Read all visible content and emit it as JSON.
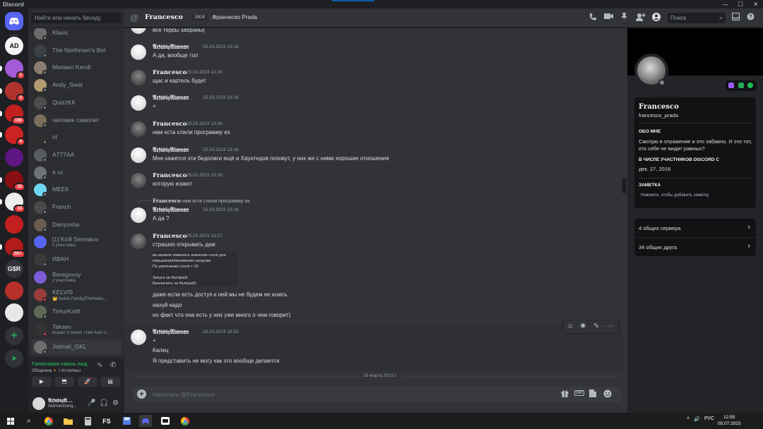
{
  "titlebar": {
    "app": "Discord",
    "min": "—",
    "max": "☐",
    "close": "✕"
  },
  "rail": {
    "servers": [
      {
        "label": "AD",
        "color": "#f2f3f5",
        "textcolor": "#111214",
        "badge": ""
      },
      {
        "label": "",
        "color": "#a35bd6",
        "textcolor": "#fff",
        "badge": "3"
      },
      {
        "label": "",
        "color": "#b0342e",
        "textcolor": "#fff",
        "badge": "3"
      },
      {
        "label": "",
        "color": "#c21f1f",
        "textcolor": "#fff",
        "badge": "150"
      },
      {
        "label": "",
        "color": "#cc2222",
        "textcolor": "#fff",
        "badge": "4"
      },
      {
        "label": "",
        "color": "#5e1780",
        "textcolor": "#fff",
        "badge": ""
      },
      {
        "label": "",
        "color": "#8a0f12",
        "textcolor": "#fff",
        "badge": "10"
      },
      {
        "label": "",
        "color": "#ededed",
        "textcolor": "#111",
        "badge": "10"
      },
      {
        "label": "",
        "color": "#c21f1f",
        "textcolor": "#fff",
        "badge": ""
      },
      {
        "label": "",
        "color": "#b31b1b",
        "textcolor": "#fff",
        "badge": "1K+"
      },
      {
        "label": "G$R",
        "color": "#313338",
        "textcolor": "#f2f3f5",
        "badge": ""
      },
      {
        "label": "",
        "color": "#b8302a",
        "textcolor": "#fff",
        "badge": ""
      },
      {
        "label": "",
        "color": "#e8e8e8",
        "textcolor": "#111",
        "badge": ""
      }
    ],
    "add": "+",
    "explore": "➤"
  },
  "sidebar": {
    "search_placeholder": "Найти или начать беседу",
    "dms": [
      {
        "name": "Klaus.",
        "sub": "",
        "avatar": "#6b6b6b",
        "status": "#80848e"
      },
      {
        "name": "The Northmen's Bot",
        "sub": "",
        "avatar": "#3c3f45",
        "status": "#80848e"
      },
      {
        "name": "Михаил Kendi",
        "sub": "",
        "avatar": "#8d7d70",
        "status": "#80848e"
      },
      {
        "name": "Andy_Swat",
        "sub": "",
        "avatar": "#b29b71",
        "status": "#80848e"
      },
      {
        "name": "QuizzKK",
        "sub": "",
        "avatar": "#4d4d4d",
        "status": "#80848e"
      },
      {
        "name": "человек самолет",
        "sub": "",
        "avatar": "#7b6e5a",
        "status": "#80848e"
      },
      {
        "name": "nt",
        "sub": "",
        "avatar": "#2f2f2f",
        "status": "#80848e"
      },
      {
        "name": "A777AA",
        "sub": "",
        "avatar": "#5a5c63",
        "status": "#80848e"
      },
      {
        "name": "я хз",
        "sub": "",
        "avatar": "#6f7376",
        "status": "#80848e"
      },
      {
        "name": "MEE6",
        "sub": "",
        "avatar": "#6fd6f2",
        "status": "#80848e"
      },
      {
        "name": "Franch",
        "sub": "",
        "avatar": "#4a4a4a",
        "status": "#80848e"
      },
      {
        "name": "Danyusha",
        "sub": "",
        "avatar": "#6a5d4f",
        "status": "#80848e"
      },
      {
        "name": "[1] Kirill Semakov",
        "sub": "2 участника",
        "avatar": "#5865f2",
        "status": ""
      },
      {
        "name": "ИВАН",
        "sub": "",
        "avatar": "#3a3a3a",
        "status": "#80848e"
      },
      {
        "name": "Beregovoy",
        "sub": "2 участника",
        "avatar": "#7c5bd6",
        "status": ""
      },
      {
        "name": "KELVIS",
        "sub": "👑 Kelvis Family|TheKelvis...",
        "avatar": "#9b3b3b",
        "status": "#f23f43"
      },
      {
        "name": "TimurKraft",
        "sub": "",
        "avatar": "#5f6a55",
        "status": "#80848e"
      },
      {
        "name": "Takaev",
        "sub": "Играет в Grand Theft Auto S...",
        "avatar": "#333",
        "status": "#f23f43"
      },
      {
        "name": "Joimati_GKL",
        "sub": "",
        "avatar": "#6e6e6e",
        "status": "#80848e"
      }
    ],
    "voice": {
      "connected": "Голосовая связь под",
      "channel": "Общение🔸 / АтлиАны",
      "btn_video": "▶",
      "btn_screen": "⬒",
      "btn_activity": "🚀",
      "btn_soundboard": "▤",
      "noise_icon": "∿",
      "disconnect_icon": "✆"
    },
    "user": {
      "name": "𝔄𝔯𝔣𝔞𝔡𝔦𝔶𝔄...",
      "sub": "AtamanGang...",
      "mic": "🎤",
      "headset": "🎧",
      "settings": "⚙"
    }
  },
  "header": {
    "at": "@",
    "name": "Francesco",
    "aka": "AKA",
    "aka_name": ".Франческо Prada",
    "search_placeholder": "Поиск",
    "icons": [
      "call",
      "video",
      "pin",
      "add-friend",
      "profile",
      "inbox",
      "help"
    ]
  },
  "messages": [
    {
      "type": "cont",
      "text": "все терры забраны("
    },
    {
      "type": "msg",
      "author": "𝔄𝔯𝔣𝔞𝔡𝔦𝔶𝔄𝔱𝔞𝔪𝔞𝔫",
      "time": "25.03.2023 13:16",
      "avatar": "ar",
      "lines": [
        "А да, вообще топ"
      ]
    },
    {
      "type": "msg",
      "author": "Francesco",
      "time": "25.03.2023 13:16",
      "avatar": "fr",
      "lines": [
        "щас и картель будет"
      ]
    },
    {
      "type": "msg",
      "author": "𝔄𝔯𝔣𝔞𝔡𝔦𝔶𝔄𝔱𝔞𝔪𝔞𝔫",
      "time": "25.03.2023 13:16",
      "avatar": "ar",
      "lines": [
        "+"
      ]
    },
    {
      "type": "msg",
      "author": "Francesco",
      "time": "25.03.2023 13:16",
      "avatar": "fr",
      "lines": [
        "нам кста слили программу их"
      ]
    },
    {
      "type": "msg",
      "author": "𝔄𝔯𝔣𝔞𝔡𝔦𝔶𝔄𝔱𝔞𝔪𝔞𝔫",
      "time": "25.03.2023 13:16",
      "avatar": "ar",
      "lines": [
        "Мне кажется эти бедолаги ещё и Хаунтедов позовут, у них же с ними хорошие отношения"
      ]
    },
    {
      "type": "msg",
      "author": "Francesco",
      "time": "25.03.2023 13:16",
      "avatar": "fr",
      "lines": [
        "которую юзают"
      ]
    },
    {
      "type": "msg",
      "author": "𝔄𝔯𝔣𝔞𝔡𝔦𝔶𝔄𝔱𝔞𝔪𝔞𝔫",
      "time": "25.03.2023 13:16",
      "avatar": "ar",
      "lines": [
        "А да ?"
      ],
      "reply_author": "Francesco",
      "reply_text": "нам кста слили программу их"
    },
    {
      "type": "msg",
      "author": "Francesco",
      "time": "25.03.2023 13:17",
      "avatar": "fr",
      "lines": [
        "страшно открывать даж"
      ],
      "attachment": [
        "вы можете изменить значение count для",
        "повышения/понижения нагрузки",
        "По умолчанию count = 10",
        "",
        "Запуск на Numpad1",
        "Выключить на Numpad2"
      ],
      "after": [
        "даже если есть доступ к ней мы не будем ее юзать",
        "нахуй надо",
        "но факт что она есть у них уже много о чем говорит)"
      ]
    },
    {
      "type": "msg",
      "author": "𝔄𝔯𝔣𝔞𝔡𝔦𝔶𝔄𝔱𝔞𝔪𝔞𝔫",
      "time": "25.03.2023 18:53",
      "avatar": "ar",
      "lines": [
        "+",
        "Капец",
        "Я представить не могу как это вообще делается"
      ]
    }
  ],
  "date_divider": "29 марта 2023 г.",
  "composer": {
    "placeholder": "Написать @Francesco",
    "gif": "GIF"
  },
  "profile": {
    "name": "Francesco",
    "username": "francesco_prada",
    "about_title": "ОБО МНЕ",
    "about": "Смотрю в отражение и это забавно. И это тот, кто себе не видит равных?",
    "member_title": "В ЧИСЛЕ УЧАСТНИКОВ DISCORD С",
    "member_since": "дек. 27, 2016",
    "note_title": "ЗАМЕТКА",
    "note_placeholder": "Нажмите, чтобы добавить заметку",
    "mutual_servers": "4 общих сервера",
    "mutual_friends": "34 общих друга"
  },
  "taskbar": {
    "lang": "РУС",
    "time": "12:55",
    "date": "05.07.2023",
    "fs": "FS"
  },
  "colors": {
    "accent": "#5865f2",
    "online": "#23a55a",
    "dnd": "#f23f43",
    "offline": "#80848e"
  }
}
